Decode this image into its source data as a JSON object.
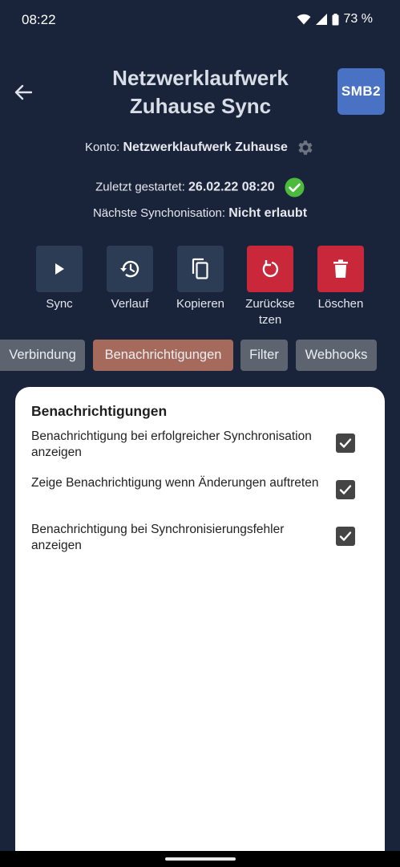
{
  "status": {
    "time": "08:22",
    "battery": "73 %"
  },
  "header": {
    "title": "Netzwerklaufwerk Zuhause Sync",
    "badge": "SMB2"
  },
  "info": {
    "konto_label": "Konto:",
    "konto_value": "Netzwerklaufwerk Zuhause",
    "zuletzt_label": "Zuletzt gestartet:",
    "zuletzt_value": "26.02.22 08:20",
    "naechste_label": "Nächste Synchonisation:",
    "naechste_value": "Nicht erlaubt"
  },
  "actions": [
    {
      "label": "Sync",
      "icon": "play-icon"
    },
    {
      "label": "Verlauf",
      "icon": "history-icon"
    },
    {
      "label": "Kopieren",
      "icon": "copy-icon"
    },
    {
      "label": "Zurückse\ntzen",
      "icon": "reset-icon"
    },
    {
      "label": "Löschen",
      "icon": "trash-icon"
    }
  ],
  "tabs": [
    {
      "label": "Verbindung"
    },
    {
      "label": "Benachrichtigungen",
      "active": true
    },
    {
      "label": "Filter"
    },
    {
      "label": "Webhooks"
    }
  ],
  "card": {
    "title": "Benachrichtigungen",
    "settings": [
      {
        "label": "Benachrichtigung bei erfolgreicher Synchronisation anzeigen",
        "checked": true
      },
      {
        "label": "Zeige Benachrichtigung wenn Änderungen auftreten",
        "checked": true
      },
      {
        "label": "Benachrichtigung bei Synchronisierungsfehler anzeigen",
        "checked": true
      }
    ]
  },
  "colors": {
    "background": "#19243a",
    "tile_dark": "#2d3c55",
    "tile_red": "#c9283a",
    "tab_active": "#a56a5c",
    "tab_inactive": "#5d6470",
    "badge": "#4a72c4",
    "success": "#4cbb3c"
  }
}
